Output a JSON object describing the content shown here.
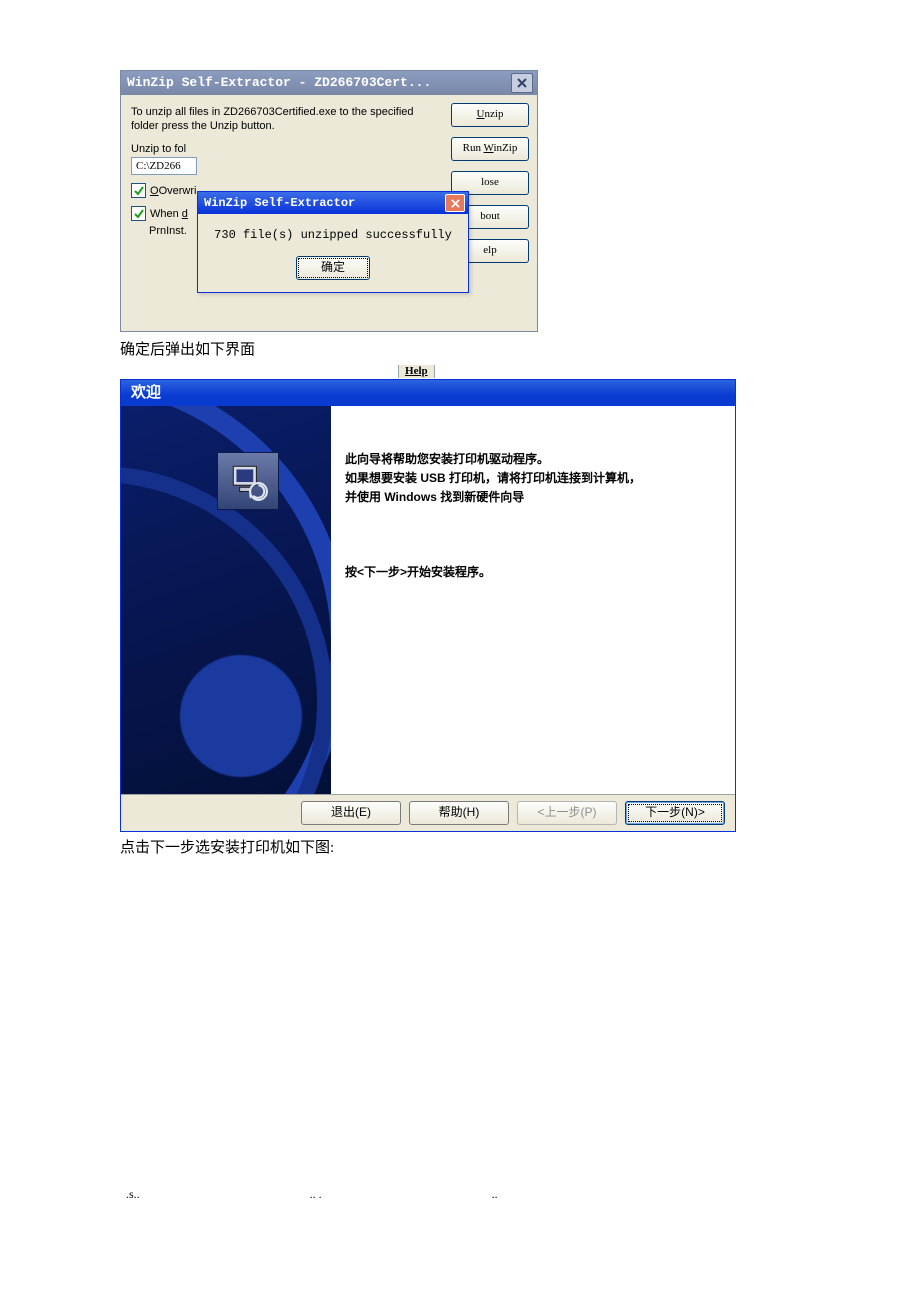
{
  "winzip_outer": {
    "title": "WinZip Self-Extractor - ZD266703Cert...",
    "instruction": "To unzip all files in ZD266703Certified.exe to the specified folder press the Unzip button.",
    "unzip_to_label": "Unzip to fol",
    "unzip_to_value": "C:\\ZD266",
    "overwrite_label": "Overwri",
    "when_done_label": "When d",
    "prn_label": "PrnInst.",
    "buttons": {
      "unzip": "Unzip",
      "winzip": "WinZip",
      "close": "lose",
      "about": "bout",
      "help": "elp"
    }
  },
  "msgbox": {
    "title": "WinZip Self-Extractor",
    "message": "730 file(s) unzipped successfully",
    "ok": "确定"
  },
  "caption1": "确定后弹出如下界面",
  "help_frag": "Help",
  "wizard": {
    "title": "欢迎",
    "line1": "此向导将帮助您安装打印机驱动程序。",
    "line2": "如果想要安装 USB 打印机，请将打印机连接到计算机，",
    "line3": "并使用 Windows 找到新硬件向导",
    "line4": "按<下一步>开始安装程序。",
    "buttons": {
      "exit": "退出(E)",
      "help": "帮助(H)",
      "prev": "<上一步(P)",
      "next": "下一步(N)>"
    }
  },
  "caption2": "点击下一步选安装打印机如下图:",
  "footer": {
    "a": ".s..",
    "b": ".. .",
    "c": ".."
  }
}
